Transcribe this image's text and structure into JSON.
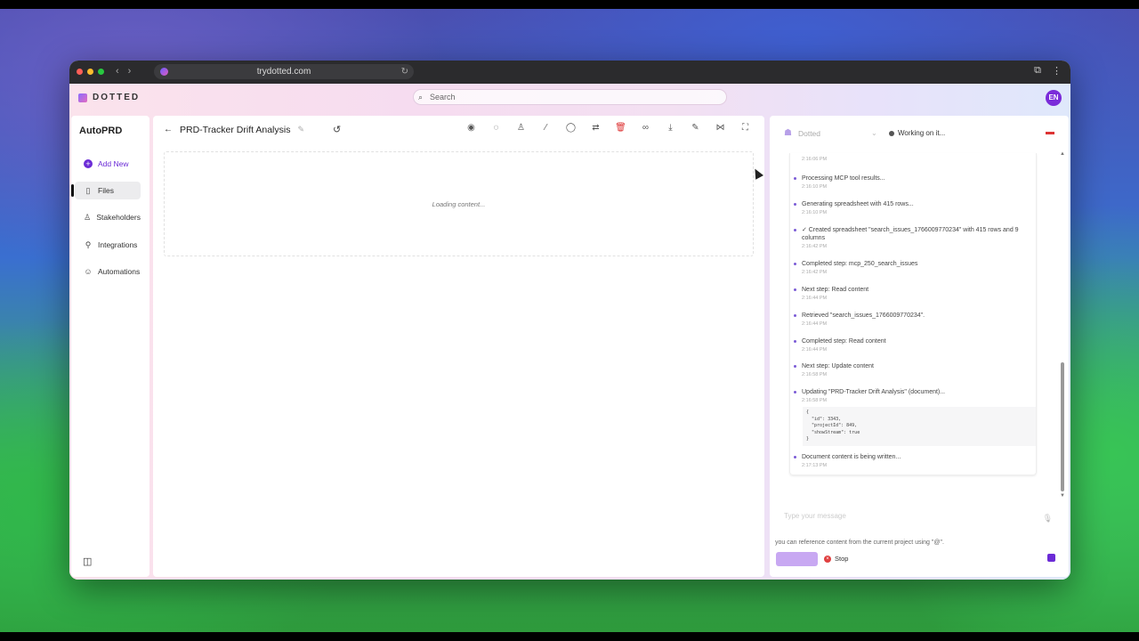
{
  "browser": {
    "url": "trydotted.com"
  },
  "app": {
    "logo": "DOTTED",
    "search_placeholder": "Search",
    "avatar_initials": "EN"
  },
  "sidebar": {
    "title": "AutoPRD",
    "items": [
      {
        "label": "Add New",
        "icon": "plus-circle-icon"
      },
      {
        "label": "Files",
        "icon": "file-icon",
        "active": true
      },
      {
        "label": "Stakeholders",
        "icon": "user-icon"
      },
      {
        "label": "Integrations",
        "icon": "plug-icon"
      },
      {
        "label": "Automations",
        "icon": "robot-icon"
      }
    ]
  },
  "document": {
    "title": "PRD-Tracker Drift Analysis",
    "loading_text": "Loading content..."
  },
  "chat": {
    "agent_name": "Dotted",
    "status": "Working on it...",
    "log": [
      {
        "text": "",
        "time": "2:16:06 PM"
      },
      {
        "text": "Processing MCP tool results...",
        "time": "2:16:10 PM"
      },
      {
        "text": "Generating spreadsheet with 415 rows...",
        "time": "2:16:10 PM"
      },
      {
        "text": "✓ Created spreadsheet \"search_issues_1766009770234\" with 415 rows and 9 columns",
        "time": "2:16:42 PM"
      },
      {
        "text": "Completed step: mcp_250_search_issues",
        "time": "2:16:42 PM"
      },
      {
        "text": "Next step: Read content",
        "time": "2:16:44 PM"
      },
      {
        "text": "Retrieved \"search_issues_1766009770234\".",
        "time": "2:16:44 PM"
      },
      {
        "text": "Completed step: Read content",
        "time": "2:16:44 PM"
      },
      {
        "text": "Next step: Update content",
        "time": "2:16:58 PM"
      },
      {
        "text": "Updating \"PRD-Tracker Drift Analysis\" (document)...",
        "time": "2:16:58 PM"
      },
      {
        "text": "Document content is being written...",
        "time": "2:17:13 PM"
      }
    ],
    "code": "{\n  \"id\": 3343,\n  \"projectId\": 849,\n  \"showStream\": true\n}",
    "input_placeholder": "Type your message",
    "hint": "you can reference content from the current project using \"@\".",
    "stop_label": "Stop"
  }
}
